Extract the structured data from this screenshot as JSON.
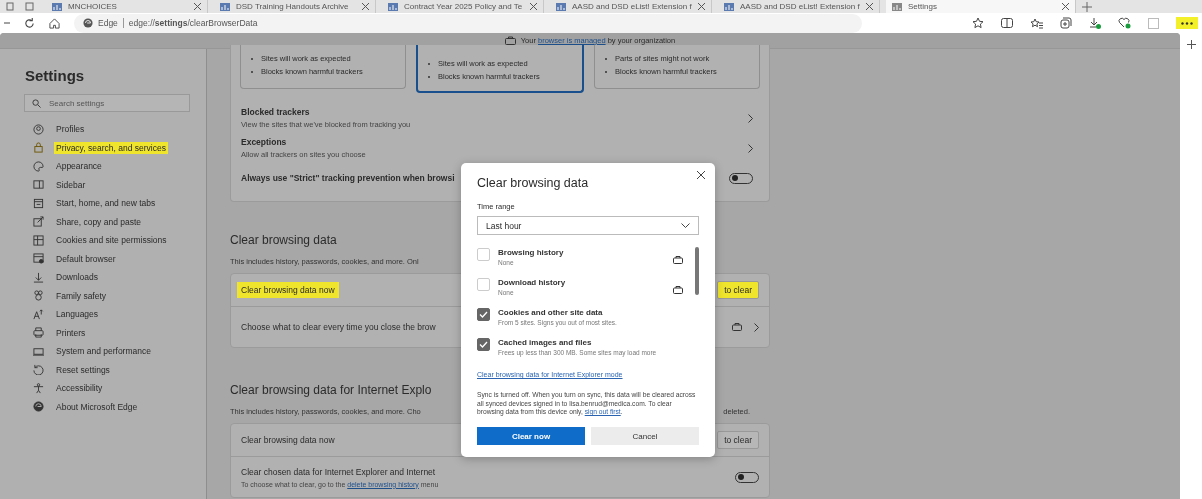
{
  "tabs": [
    {
      "label": "MNCHOICES",
      "selected": false
    },
    {
      "label": "DSD Training Handouts Archive",
      "selected": false
    },
    {
      "label": "Contract Year 2025 Policy and Te",
      "selected": false
    },
    {
      "label": "AASD and DSD eList! Extension f",
      "selected": false
    },
    {
      "label": "AASD and DSD eList! Extension f",
      "selected": false
    },
    {
      "label": "Settings",
      "selected": true
    }
  ],
  "address_bar": {
    "site_label": "Edge",
    "url": "edge://**settings**/clearBrowserData"
  },
  "toolbar": {
    "more_highlighted": true
  },
  "banner": {
    "before": "Your ",
    "link": "browser is managed",
    "after": " by your organization"
  },
  "sidebar": {
    "title": "Settings",
    "search": {
      "placeholder": "Search settings"
    },
    "items": [
      {
        "label": "Profiles",
        "selected": false,
        "highlighted": false
      },
      {
        "label": "Privacy, search, and services",
        "selected": true,
        "highlighted": true
      },
      {
        "label": "Appearance",
        "selected": false,
        "highlighted": false
      },
      {
        "label": "Sidebar",
        "selected": false,
        "highlighted": false
      },
      {
        "label": "Start, home, and new tabs",
        "selected": false,
        "highlighted": false
      },
      {
        "label": "Share, copy and paste",
        "selected": false,
        "highlighted": false
      },
      {
        "label": "Cookies and site permissions",
        "selected": false,
        "highlighted": false
      },
      {
        "label": "Default browser",
        "selected": false,
        "highlighted": false
      },
      {
        "label": "Downloads",
        "selected": false,
        "highlighted": false
      },
      {
        "label": "Family safety",
        "selected": false,
        "highlighted": false
      },
      {
        "label": "Languages",
        "selected": false,
        "highlighted": false
      },
      {
        "label": "Printers",
        "selected": false,
        "highlighted": false
      },
      {
        "label": "System and performance",
        "selected": false,
        "highlighted": false
      },
      {
        "label": "Reset settings",
        "selected": false,
        "highlighted": false
      },
      {
        "label": "Accessibility",
        "selected": false,
        "highlighted": false
      },
      {
        "label": "About Microsoft Edge",
        "selected": false,
        "highlighted": false
      }
    ]
  },
  "tracking_cards": [
    {
      "bullets": [
        "Sites will work as expected",
        "Blocks known harmful trackers"
      ],
      "selected": false
    },
    {
      "bullets": [
        "Sites will work as expected",
        "Blocks known harmful trackers"
      ],
      "selected": true
    },
    {
      "bullets": [
        "Parts of sites might not work",
        "Blocks known harmful trackers"
      ],
      "selected": false
    }
  ],
  "tracker_rows": [
    {
      "title": "Blocked trackers",
      "description": "View the sites that we've blocked from tracking you"
    },
    {
      "title": "Exceptions",
      "description": "Allow all trackers on sites you choose"
    }
  ],
  "strict_row": {
    "label": "Always use \"Strict\" tracking prevention when browsi",
    "on": false
  },
  "clear_section": {
    "heading": "Clear browsing data",
    "description": "This includes history, passwords, cookies, and more. Onl",
    "rows": [
      {
        "kind": "button",
        "label": "Clear browsing data now",
        "button": "to clear",
        "highlighted": true
      },
      {
        "kind": "chevron",
        "label": "Choose what to clear every time you close the brow"
      }
    ]
  },
  "ie_section": {
    "heading": "Clear browsing data for Internet Explo",
    "description": "This includes history, passwords, cookies, and more. Cho",
    "description_end": "deleted.",
    "rows": [
      {
        "kind": "button",
        "label": "Clear browsing data now",
        "button": "to clear",
        "highlighted": false
      },
      {
        "kind": "toggle",
        "label": "Clear chosen data for Internet Explorer and Internet",
        "on": false,
        "note": "To choose what to clear, go to the ",
        "note_link": "delete browsing history",
        "note_end": " menu"
      }
    ]
  },
  "dialog": {
    "title": "Clear browsing data",
    "time_range_label": "Time range",
    "time_range": "Last hour",
    "items": [
      {
        "label": "Browsing history",
        "detail": "None",
        "checked": false,
        "locked": true
      },
      {
        "label": "Download history",
        "detail": "None",
        "checked": false,
        "locked": true
      },
      {
        "label": "Cookies and other site data",
        "detail": "From 5 sites. Signs you out of most sites.",
        "checked": true,
        "locked": false
      },
      {
        "label": "Cached images and files",
        "detail": "Frees up less than 300 MB. Some sites may load more",
        "checked": true,
        "locked": false
      }
    ],
    "ie_link": "Clear browsing data for Internet Explorer mode",
    "sync_note": "Sync is turned off. When you turn on sync, this data will be cleared across all synced devices signed in to lisa.benrud@medica.com. To clear browsing data from this device only, ",
    "sync_link": "sign out first",
    "sync_end": ".",
    "buttons": [
      {
        "label": "Clear now",
        "kind": "primary"
      },
      {
        "label": "Cancel",
        "kind": "secondary"
      }
    ]
  }
}
